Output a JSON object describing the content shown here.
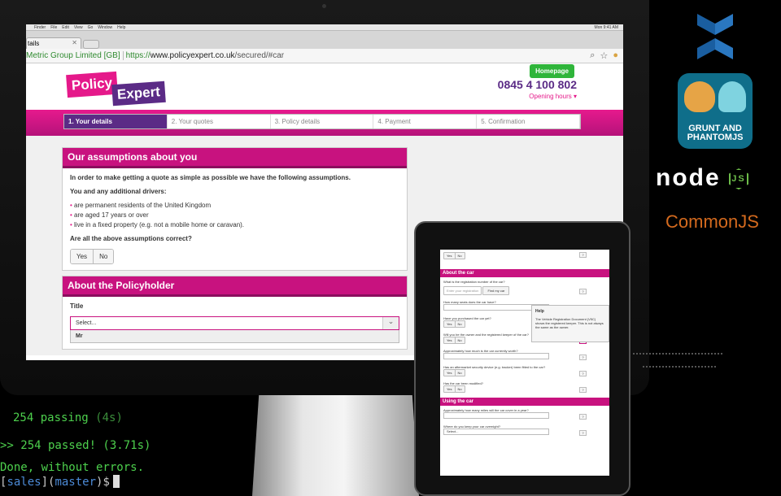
{
  "terminal": {
    "line1_main": "254 passing",
    "line1_time": "(4s)",
    "line2": ">> 254 passed! (3.71s)",
    "line3": "Done, without errors.",
    "prompt_sales": "sales",
    "prompt_master": "master",
    "prompt_symbol": "$"
  },
  "os_menu": [
    "Finder",
    "File",
    "Edit",
    "View",
    "Go",
    "Window",
    "Help"
  ],
  "os_clock": "Mon 9:41 AM",
  "browser": {
    "tab_title": "tails",
    "ev_cert": "Metric Group Limited [GB]",
    "url_scheme": "https://",
    "url_domain": "www.policyexpert.co.uk",
    "url_path": "/secured/#car"
  },
  "site": {
    "logo_part1": "Policy",
    "logo_part2": "Expert",
    "homepage_button": "Homepage",
    "phone": "0845 4 100 802",
    "opening_hours": "Opening hours",
    "steps": [
      "1. Your details",
      "2. Your quotes",
      "3. Policy details",
      "4. Payment",
      "5. Confirmation"
    ]
  },
  "assumptions": {
    "title": "Our assumptions about you",
    "intro": "In order to make getting a quote as simple as possible we have the following assumptions.",
    "drivers_heading": "You and any additional drivers:",
    "items": [
      "are permanent residents of the United Kingdom",
      "are aged 17 years or over",
      "live in a fixed property (e.g. not a mobile home or caravan)."
    ],
    "question": "Are all the above assumptions correct?",
    "yes": "Yes",
    "no": "No"
  },
  "policyholder": {
    "title": "About the Policyholder",
    "field_label": "Title",
    "select_placeholder": "Select...",
    "option_first": "Mr"
  },
  "tablet": {
    "section_car": "About the car",
    "q_reg": "What is the registration number of the car?",
    "reg_placeholder": "Enter your registration",
    "find_car": "Find my car",
    "q_seats": "How many seats does the car have?",
    "q_purchased": "Have you purchased the car yet?",
    "q_owner": "Will you be the owner and the registered keeper of the car?",
    "q_worth": "Approximately how much is the car currently worth?",
    "q_security": "Has an aftermarket security device (e.g. tracker) been fitted to the car?",
    "q_modified": "Has the car been modified?",
    "section_using": "Using the car",
    "q_miles": "Approximately how many miles will the car cover in a year?",
    "q_overnight": "Where do you keep your car overnight?",
    "select_placeholder": "Select...",
    "help_title": "Help",
    "help_text": "The Vehicle Registration Document (V5C) shows the registered keeper. This is not always the same as the owner.",
    "yes": "Yes",
    "no": "No",
    "q_mark": "?"
  },
  "logos": {
    "grunt_label": "GRUNT AND PHANTOMJS",
    "node": "node",
    "node_js": "JS",
    "commonjs": "CommonJS"
  },
  "colors": {
    "brand_pink": "#e5198a",
    "brand_purple": "#5b2b86",
    "terminal_green": "#4dd04d"
  }
}
